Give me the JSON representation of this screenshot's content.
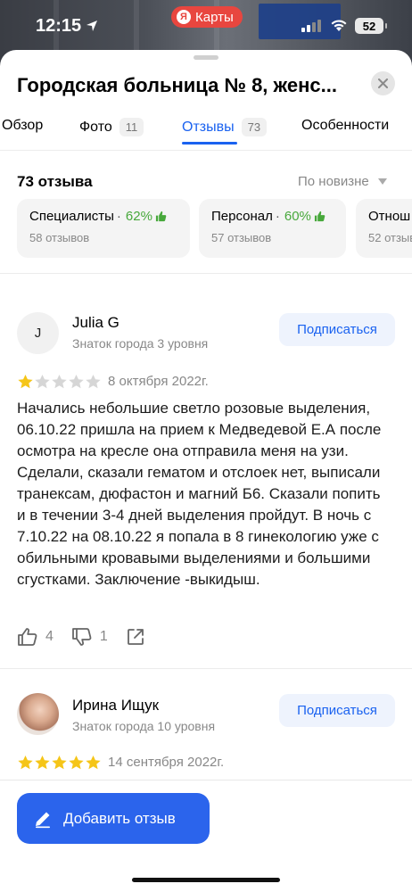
{
  "status_bar": {
    "time": "12:15",
    "app_badge": "Карты",
    "app_badge_logo": "Я",
    "battery": "52"
  },
  "header": {
    "title": "Городская больница № 8, женс..."
  },
  "tabs": [
    {
      "label": "Обзор",
      "count": ""
    },
    {
      "label": "Фото",
      "count": "11"
    },
    {
      "label": "Отзывы",
      "count": "73",
      "active": true
    },
    {
      "label": "Особенности",
      "count": ""
    }
  ],
  "reviews_summary": {
    "count_title": "73 отзыва",
    "sort_label": "По новизне"
  },
  "aspect_cards": [
    {
      "name": "Специалисты",
      "percent": "62%",
      "sub": "58 отзывов"
    },
    {
      "name": "Персонал",
      "percent": "60%",
      "sub": "57 отзывов"
    },
    {
      "name": "Отнош",
      "percent": "",
      "sub": "52 отзыв"
    }
  ],
  "reviews": [
    {
      "avatar_letter": "J",
      "author": "Julia G",
      "level": "Знаток города 3 уровня",
      "subscribe_label": "Подписаться",
      "rating": 1,
      "date": "8 октября 2022г.",
      "text": "Начались небольшие светло розовые выделения, 06.10.22 пришла на прием к Медведевой Е.А после осмотра на кресле она отправила меня на узи. Сделали, сказали гематом и отслоек нет, выписали транексам, дюфастон и магний Б6. Сказали попить и в течении 3-4 дней выделения пройдут. В ночь с 7.10.22 на 08.10.22 я попала в 8 гинекологию уже с обильными кровавыми выделениями и большими сгустками. Заключение -выкидыш.",
      "likes": "4",
      "dislikes": "1"
    },
    {
      "avatar_letter": "",
      "author": "Ирина Ищук",
      "level": "Знаток города 10 уровня",
      "subscribe_label": "Подписаться",
      "rating": 5,
      "date": "14 сентября 2022г."
    }
  ],
  "bottom": {
    "add_review_label": "Добавить отзыв"
  },
  "colors": {
    "accent": "#1a62f0",
    "button": "#2b64ec",
    "positive": "#47a83b",
    "star": "#f5c518",
    "star_empty": "#d6d6d6"
  }
}
